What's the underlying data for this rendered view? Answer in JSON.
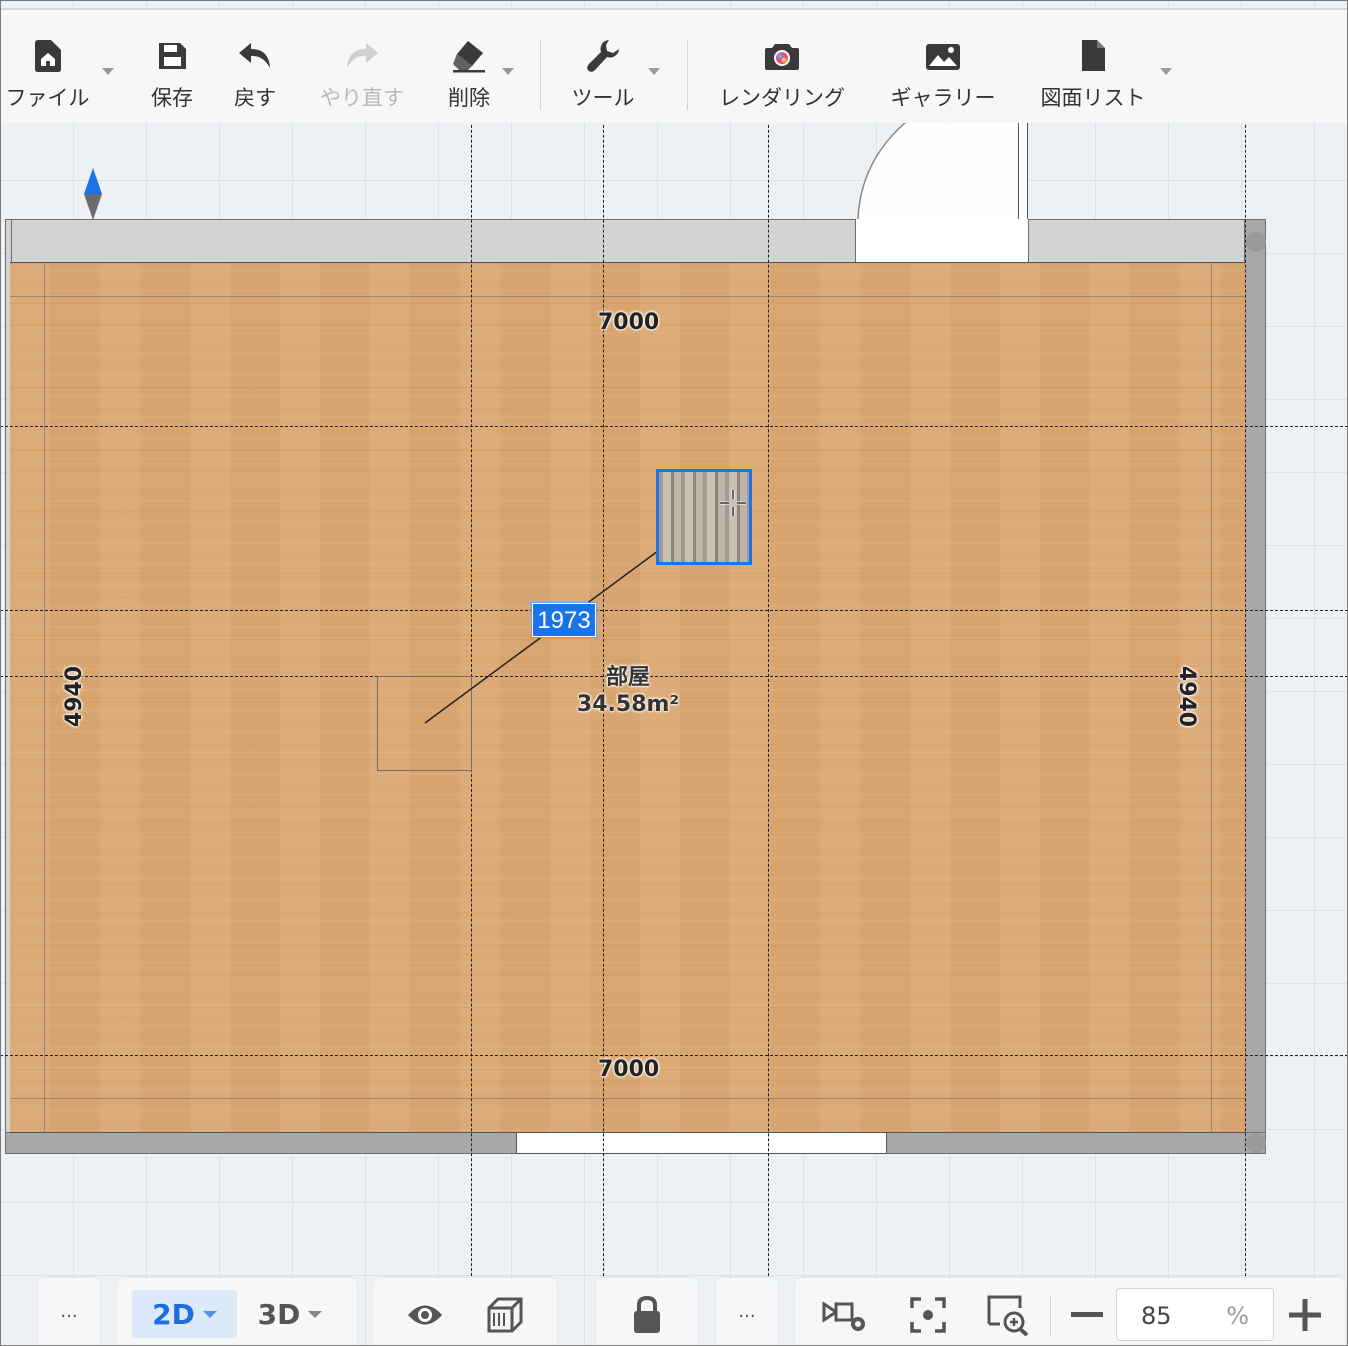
{
  "toolbar": {
    "file": "ファイル",
    "save": "保存",
    "undo": "戻す",
    "redo": "やり直す",
    "delete": "削除",
    "tools": "ツール",
    "rendering": "レンダリング",
    "gallery": "ギャラリー",
    "drawing_list": "図面リスト"
  },
  "canvas": {
    "dim_top": "7000",
    "dim_bottom": "7000",
    "dim_left": "4940",
    "dim_right": "4940",
    "room_name": "部屋",
    "room_area": "34.58m²",
    "move_distance": "1973"
  },
  "bottom": {
    "more_left": "···",
    "view_2d": "2D",
    "view_3d": "3D",
    "more_mid": "···",
    "zoom_value": "85",
    "zoom_unit": "%",
    "zoom_out": "−",
    "zoom_in": "+"
  },
  "colors": {
    "accent": "#1a73e8",
    "floor": "#dba873",
    "wall": "#d3d3d3"
  },
  "icons": [
    "home-icon",
    "save-icon",
    "undo-icon",
    "redo-icon",
    "eraser-icon",
    "wrench-icon",
    "camera-icon",
    "gallery-icon",
    "document-icon",
    "compass-icon",
    "eye-icon",
    "cube-icon",
    "lock-icon",
    "camera-settings-icon",
    "focus-icon",
    "zoom-fit-icon"
  ]
}
